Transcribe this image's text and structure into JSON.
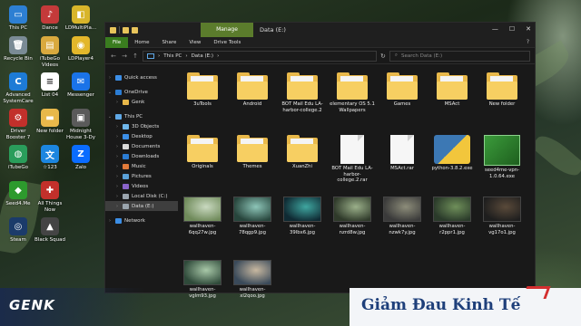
{
  "desktop": {
    "icons": [
      {
        "label": "This PC",
        "color": "#2d7fd3",
        "glyph": "▭"
      },
      {
        "label": "Dance",
        "color": "#c43a3a",
        "glyph": "♪"
      },
      {
        "label": "LDMultiPla...",
        "color": "#d8b52a",
        "glyph": "◧"
      },
      {
        "label": "Recycle Bin",
        "color": "#7a8b95",
        "glyph": "🗑"
      },
      {
        "label": "iTubeGo Videos",
        "color": "#d9a93e",
        "glyph": "▤"
      },
      {
        "label": "LDPlayer4",
        "color": "#e3b72b",
        "glyph": "◉"
      },
      {
        "label": "Advanced SystemCare",
        "color": "#1d7bd6",
        "glyph": "C"
      },
      {
        "label": "List 04",
        "color": "#ffffff",
        "glyph": "≡"
      },
      {
        "label": "Messenger",
        "color": "#1a73e8",
        "glyph": "✉"
      },
      {
        "label": "Driver Booster 7",
        "color": "#c2302b",
        "glyph": "⚙"
      },
      {
        "label": "New folder",
        "color": "#e8b84a",
        "glyph": "▬"
      },
      {
        "label": "Midnight House 3-Dy",
        "color": "#5a5a5a",
        "glyph": "▣"
      },
      {
        "label": "iTubeGo",
        "color": "#2a9d5b",
        "glyph": "◍"
      },
      {
        "label": "☆123",
        "color": "#1c86e0",
        "glyph": "文"
      },
      {
        "label": "Zalo",
        "color": "#0a6cff",
        "glyph": "Z"
      },
      {
        "label": "Seed4.Me",
        "color": "#2d9a2d",
        "glyph": "◆"
      },
      {
        "label": "All Things Now",
        "color": "#c2302b",
        "glyph": "✚"
      },
      {
        "label": "Steam",
        "color": "#1b3b6a",
        "glyph": "◎"
      },
      {
        "label": "Black Squad",
        "color": "#444",
        "glyph": "▲"
      }
    ]
  },
  "window": {
    "manage_tab": "Manage",
    "title": "Data (E:)",
    "controls": {
      "minimize": "—",
      "maximize": "☐",
      "close": "✕"
    },
    "ribbon_tabs": [
      "File",
      "Home",
      "Share",
      "View",
      "Drive Tools"
    ],
    "help": "?"
  },
  "address": {
    "back": "←",
    "forward": "→",
    "up": "↑",
    "crumb_1": "This PC",
    "crumb_2": "Data (E:)",
    "sep": "›",
    "refresh": "↻",
    "search_placeholder": "Search Data (E:)"
  },
  "nav": {
    "quick_access": "Quick access",
    "onedrive": "OneDrive",
    "genk": "Genk",
    "this_pc": "This PC",
    "objects_3d": "3D Objects",
    "desktop": "Desktop",
    "documents": "Documents",
    "downloads": "Downloads",
    "music": "Music",
    "pictures": "Pictures",
    "videos": "Videos",
    "local_disk": "Local Disk (C:)",
    "data_e": "Data (E:)",
    "network": "Network"
  },
  "files": [
    {
      "name": "3uTools",
      "kind": "folder"
    },
    {
      "name": "Android",
      "kind": "folder"
    },
    {
      "name": "BOT Mail Edu LA-harbor-college.2",
      "kind": "folder"
    },
    {
      "name": "elementary OS 5.1 Wallpapers",
      "kind": "folder"
    },
    {
      "name": "Games",
      "kind": "folder"
    },
    {
      "name": "MSAct",
      "kind": "folder"
    },
    {
      "name": "New folder",
      "kind": "folder"
    },
    {
      "name": "Originals",
      "kind": "folder"
    },
    {
      "name": "Themes",
      "kind": "folder"
    },
    {
      "name": "XuanZhi",
      "kind": "folder"
    },
    {
      "name": "BOT Mail Edu LA-harbor-college.2.rar",
      "kind": "doc"
    },
    {
      "name": "MSAct.rar",
      "kind": "doc"
    },
    {
      "name": "python-3.8.2.exe",
      "kind": "python"
    },
    {
      "name": "seed4me-vpn-1.0.64.exe",
      "kind": "installer"
    },
    {
      "name": "wallhaven-6qq27w.jpg",
      "kind": "photo",
      "c1": "#6f8a5a",
      "c2": "#c9d9c0"
    },
    {
      "name": "wallhaven-78qgp9.jpg",
      "kind": "photo",
      "c1": "#27453c",
      "c2": "#8dc5b8"
    },
    {
      "name": "wallhaven-39lbx6.jpg",
      "kind": "photo",
      "c1": "#0f2a33",
      "c2": "#3fa6a0"
    },
    {
      "name": "wallhaven-nzrd8w.jpg",
      "kind": "photo",
      "c1": "#2f3a2a",
      "c2": "#9bb08a"
    },
    {
      "name": "wallhaven-nzwk7y.jpg",
      "kind": "photo",
      "c1": "#3a3a3a",
      "c2": "#8d8d7a"
    },
    {
      "name": "wallhaven-r2ppr1.jpg",
      "kind": "photo",
      "c1": "#2a3a2a",
      "c2": "#6f8f5a"
    },
    {
      "name": "wallhaven-vg17o1.jpg",
      "kind": "photo",
      "c1": "#1e1e1e",
      "c2": "#5a4a3a"
    },
    {
      "name": "wallhaven-vglm93.jpg",
      "kind": "photo",
      "c1": "#2f4a3a",
      "c2": "#a8c8a8"
    },
    {
      "name": "wallhaven-xl2qoo.jpg",
      "kind": "photo",
      "c1": "#3a4a5a",
      "c2": "#c8b8a0"
    }
  ],
  "watermark": {
    "left": "GENK",
    "right": "Giảm Đau Kinh Tế"
  }
}
